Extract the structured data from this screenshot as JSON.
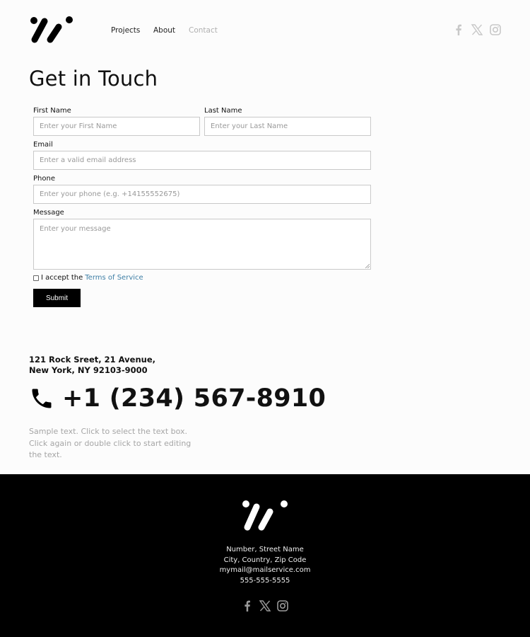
{
  "header": {
    "logo_icon": "brand-logo-icon",
    "nav": [
      {
        "label": "Projects",
        "active": false
      },
      {
        "label": "About",
        "active": false
      },
      {
        "label": "Contact",
        "active": true
      }
    ],
    "social": [
      "facebook-icon",
      "x-icon",
      "instagram-icon"
    ],
    "social_color": "#c8c8c8"
  },
  "page": {
    "title": "Get in Touch"
  },
  "form": {
    "first_name": {
      "label": "First Name",
      "value": "",
      "placeholder": "Enter your First Name"
    },
    "last_name": {
      "label": "Last Name",
      "value": "",
      "placeholder": "Enter your Last Name"
    },
    "email": {
      "label": "Email",
      "value": "",
      "placeholder": "Enter a valid email address"
    },
    "phone": {
      "label": "Phone",
      "value": "",
      "placeholder": "Enter your phone (e.g. +14155552675)"
    },
    "message": {
      "label": "Message",
      "value": "",
      "placeholder": "Enter your message"
    },
    "terms": {
      "prefix": "I accept the",
      "link": "Terms of Service",
      "checked": false,
      "link_color": "#3f7fa6"
    },
    "submit_label": "Submit"
  },
  "contact": {
    "address_line1": "121 Rock Sreet, 21 Avenue,",
    "address_line2": "New York, NY 92103-9000",
    "phone_icon": "phone-icon",
    "phone": "+1 (234) 567-8910",
    "sample_text": "Sample text. Click to select the text box. Click again or double click to start editing the text."
  },
  "footer": {
    "logo_icon": "brand-logo-icon",
    "lines": [
      "Number, Street Name",
      "City, Country, Zip Code",
      "mymail@mailservice.com",
      "555-555-5555"
    ],
    "social": [
      "facebook-icon",
      "x-icon",
      "instagram-icon"
    ],
    "social_color": "#9a9a9a",
    "background": "#000000"
  }
}
